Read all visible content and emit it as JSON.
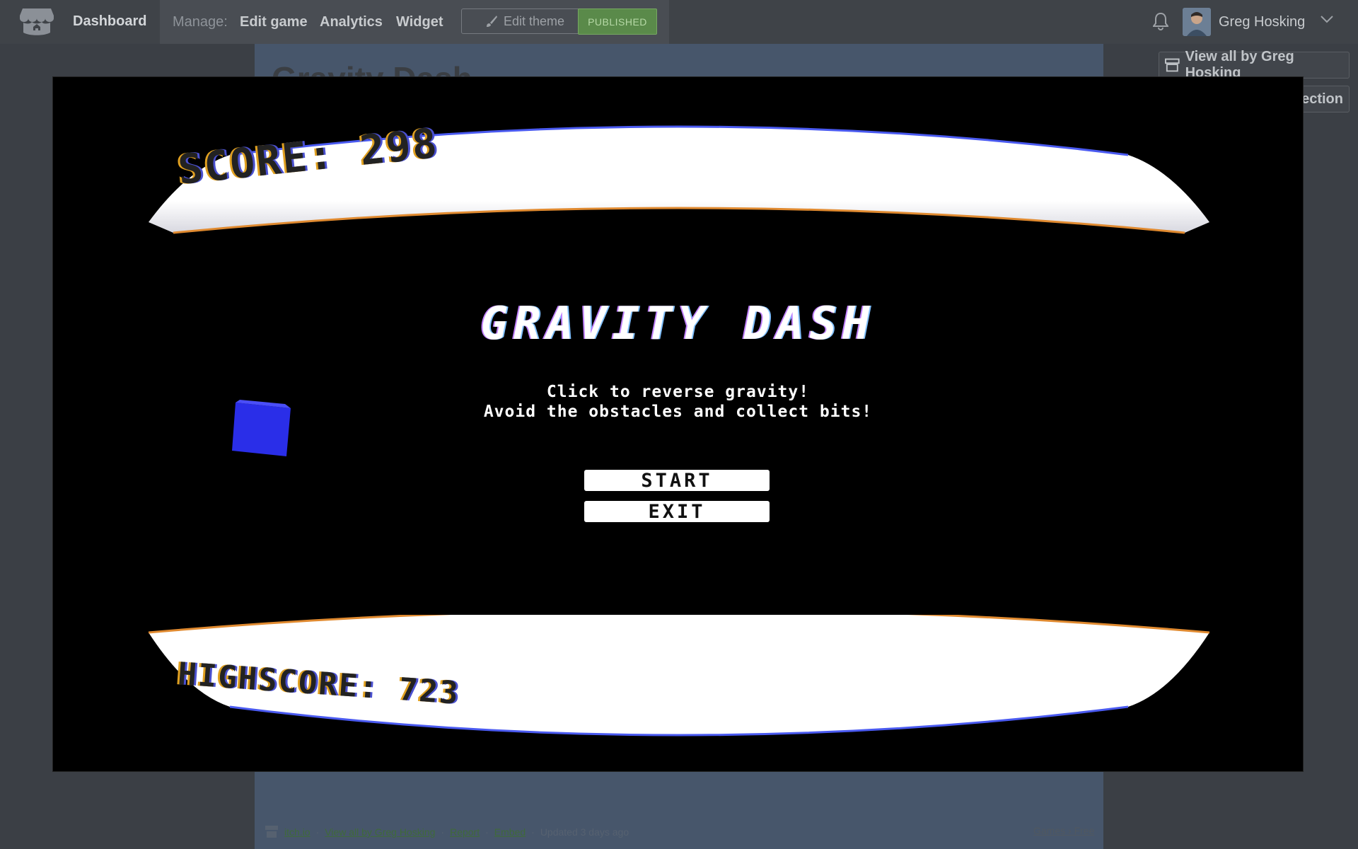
{
  "header": {
    "dashboard": "Dashboard",
    "manage_label": "Manage:",
    "nav": [
      "Edit game",
      "Analytics",
      "Widget"
    ],
    "edit_theme": "Edit theme",
    "published": "PUBLISHED",
    "username": "Greg Hosking"
  },
  "page": {
    "title": "Gravity Dash",
    "view_all": "View all by Greg Hosking",
    "collection": "ection",
    "footer": {
      "itchio": "itch.io",
      "view_all": "View all by Greg Hosking",
      "report": "Report",
      "embed": "Embed",
      "updated": "Updated 3 days ago",
      "right": "Games › Free"
    }
  },
  "game": {
    "score": "SCORE: 298",
    "highscore": "HIGHSCORE: 723",
    "title": "GRAVITY DASH",
    "instructions": [
      "Click to reverse gravity!",
      "Avoid the obstacles and collect bits!"
    ],
    "start": "START",
    "exit": "EXIT"
  },
  "colors": {
    "cube": "#2a2ee8",
    "published_bg": "#5a8a4a",
    "page_column": "#47566b"
  },
  "icons": [
    "itchio-logo-icon",
    "brush-icon",
    "bell-icon",
    "chevron-down-icon",
    "itchio-small-icon"
  ]
}
